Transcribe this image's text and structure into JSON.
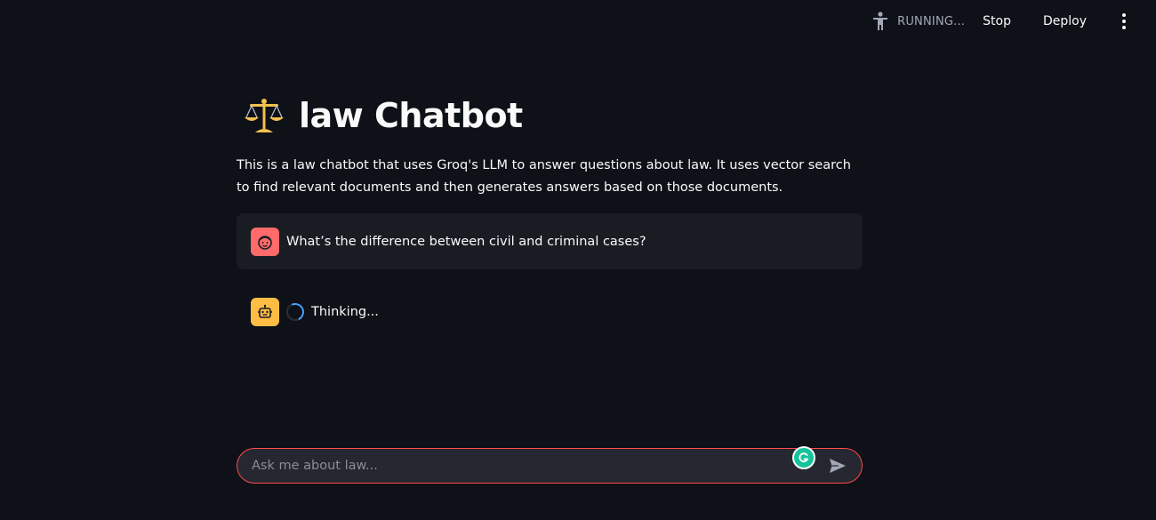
{
  "toolbar": {
    "status_text": "RUNNING...",
    "stop_label": "Stop",
    "deploy_label": "Deploy",
    "status_icon": "running-person-icon",
    "menu_icon": "more-vertical-icon"
  },
  "header": {
    "icon": "balance-scale-icon",
    "title": "law Chatbot",
    "description": "This is a law chatbot that uses Groq's LLM to answer questions about law. It uses vector search to find relevant documents and then generates answers based on those documents."
  },
  "messages": [
    {
      "role": "user",
      "avatar_icon": "user-face-icon",
      "text": "What’s the difference between civil and criminal cases?"
    },
    {
      "role": "assistant",
      "avatar_icon": "robot-icon",
      "text": "Thinking..."
    }
  ],
  "chat_input": {
    "placeholder": "Ask me about law...",
    "value": "",
    "send_icon": "send-icon",
    "grammarly_icon": "grammarly-icon"
  },
  "colors": {
    "background": "#0e1117",
    "user_avatar": "#ff6b6b",
    "bot_avatar": "#ffbd45",
    "input_border": "#ff4b4b",
    "spinner": "#4aa3ff",
    "grammarly": "#15c39a"
  }
}
